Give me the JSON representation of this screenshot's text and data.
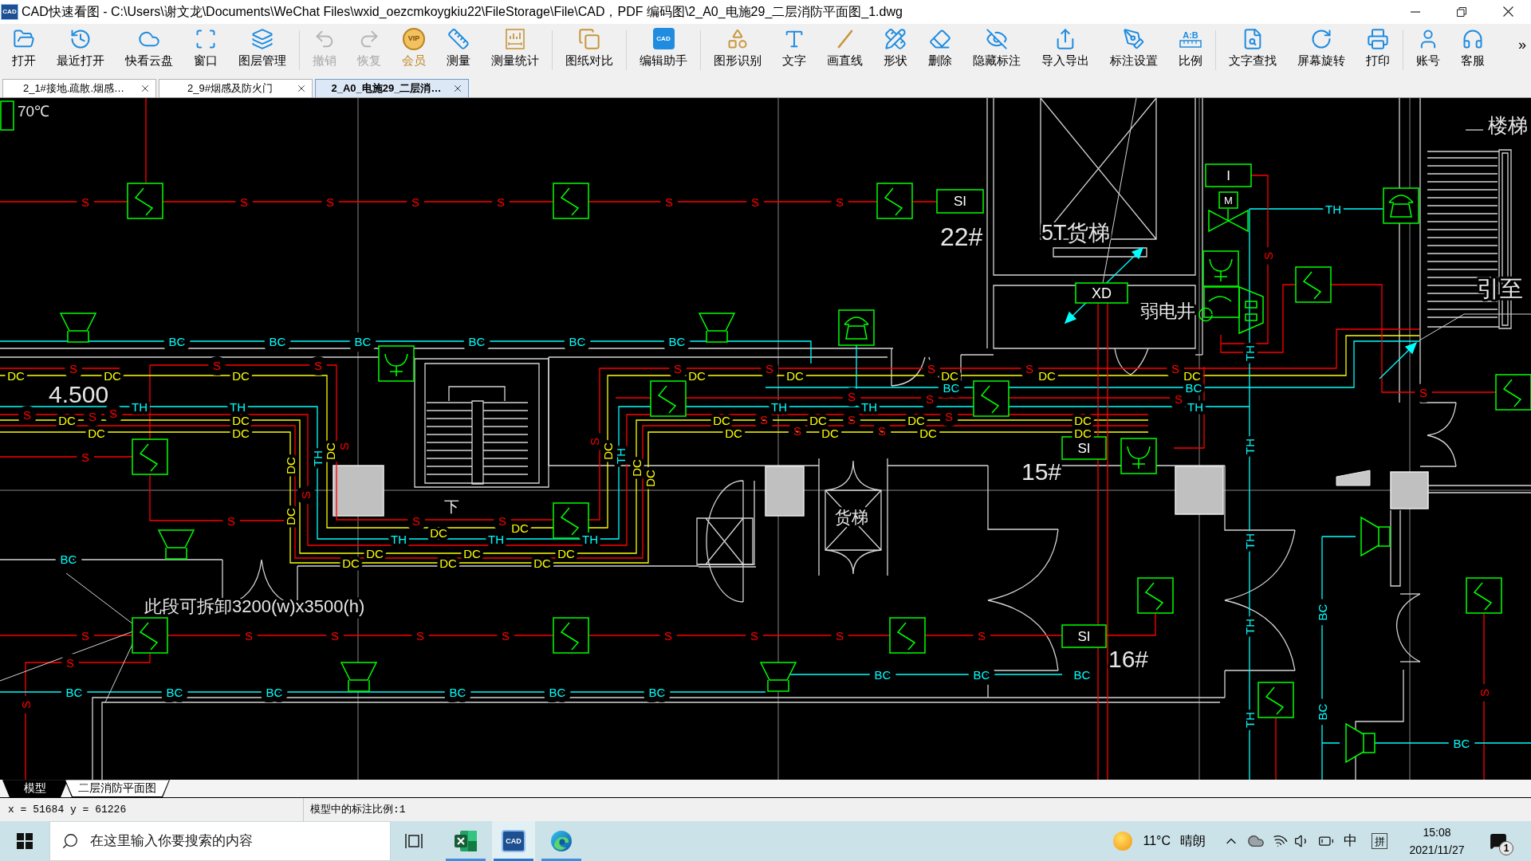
{
  "window": {
    "icon_text": "CAD",
    "title": "CAD快速看图 - C:\\Users\\谢文龙\\Documents\\WeChat Files\\wxid_oezcmkoygkiu22\\FileStorage\\File\\CAD，PDF 编码图\\2_A0_电施29_二层消防平面图_1.dwg"
  },
  "toolbar": {
    "groups": [
      [
        {
          "label": "打开",
          "disabled": false
        },
        {
          "label": "最近打开",
          "disabled": false
        },
        {
          "label": "快看云盘",
          "disabled": false
        },
        {
          "label": "窗口",
          "disabled": false
        },
        {
          "label": "图层管理",
          "disabled": false
        }
      ],
      [
        {
          "label": "撤销",
          "disabled": true
        },
        {
          "label": "恢复",
          "disabled": true
        },
        {
          "label": "会员",
          "disabled": false,
          "icon_text": "VIP"
        },
        {
          "label": "测量",
          "disabled": false
        },
        {
          "label": "测量统计",
          "disabled": false
        }
      ],
      [
        {
          "label": "图纸对比",
          "disabled": false
        }
      ],
      [
        {
          "label": "编辑助手",
          "disabled": false,
          "icon_text": "CAD"
        }
      ],
      [
        {
          "label": "图形识别",
          "disabled": false
        },
        {
          "label": "文字",
          "disabled": false
        },
        {
          "label": "画直线",
          "disabled": false
        },
        {
          "label": "形状",
          "disabled": false
        },
        {
          "label": "删除",
          "disabled": false
        },
        {
          "label": "隐藏标注",
          "disabled": false
        },
        {
          "label": "导入导出",
          "disabled": false
        },
        {
          "label": "标注设置",
          "disabled": false
        },
        {
          "label": "比例",
          "disabled": false,
          "icon_text": "A:B"
        }
      ],
      [
        {
          "label": "文字查找",
          "disabled": false
        },
        {
          "label": "屏幕旋转",
          "disabled": false
        },
        {
          "label": "打印",
          "disabled": false
        }
      ],
      [
        {
          "label": "账号",
          "disabled": false
        },
        {
          "label": "客服",
          "disabled": false
        }
      ]
    ],
    "more": "»"
  },
  "tabs": [
    {
      "label": "2_1#接地.疏散.烟感…",
      "selected": false
    },
    {
      "label": "2_9#烟感及防火门",
      "selected": false
    },
    {
      "label": "2_A0_电施29_二层消…",
      "selected": true
    }
  ],
  "plan": {
    "wire_labels": [
      {
        "color": "#ff0000",
        "texts": [
          "S",
          "S",
          "S",
          "S",
          "S",
          "S",
          "S",
          "S",
          "S",
          "S",
          "S",
          "S",
          "S",
          "S",
          "S",
          "S",
          "S",
          "S",
          "S",
          "S",
          "S",
          "S",
          "S",
          "S",
          "S",
          "S",
          "S",
          "S",
          "S",
          "S",
          "S",
          "S",
          "S",
          "S",
          "S",
          "S",
          "S",
          "S",
          "S",
          "S",
          "S",
          "S",
          "S",
          "S",
          "S",
          "S",
          "S",
          "S"
        ]
      },
      {
        "color": "#00ffff",
        "texts": [
          "BC",
          "BC",
          "BC",
          "BC",
          "BC",
          "BC",
          "BC",
          "BC",
          "BC",
          "BC",
          "BC",
          "BC",
          "BC",
          "BC",
          "BC",
          "BC",
          "BC",
          "BC",
          "BC",
          "BC",
          "BC"
        ]
      },
      {
        "color": "#00ffff",
        "texts": [
          "TH",
          "TH",
          "TH",
          "TH",
          "TH",
          "TH",
          "TH",
          "TH",
          "TH",
          "TH",
          "TH",
          "TH",
          "TH",
          "TH",
          "TH",
          "TH"
        ]
      },
      {
        "color": "#ffff00",
        "texts": [
          "DC",
          "DC",
          "DC",
          "DC",
          "DC",
          "DC",
          "DC",
          "DC",
          "DC",
          "DC",
          "DC",
          "DC",
          "DC",
          "DC",
          "DC",
          "DC",
          "DC",
          "DC",
          "DC",
          "DC",
          "DC",
          "DC",
          "DC",
          "DC",
          "DC",
          "DC",
          "DC",
          "DC",
          "DC",
          "DC",
          "DC",
          "DC",
          "DC",
          "DC"
        ]
      }
    ],
    "tags": [
      "SI",
      "SI",
      "SI",
      "I",
      "M",
      "XD"
    ],
    "room_labels": [
      "70℃",
      "4.500",
      "22#",
      "5T货梯",
      "弱电井",
      "15#",
      "16#",
      "货梯",
      "楼梯",
      "引至",
      "此段可拆卸3200(w)x3500(h)",
      "下"
    ]
  },
  "layout_tabs": [
    {
      "label": "模型",
      "selected": true
    },
    {
      "label": "二层消防平面图",
      "selected": false
    }
  ],
  "status_bar": {
    "coordinates": "x = 51684 y = 61226",
    "annotation_scale": "模型中的标注比例:1"
  },
  "taskbar": {
    "search": {
      "placeholder": "在这里输入你要搜索的内容"
    },
    "apps": [
      {
        "selected": false
      },
      {
        "selected": true,
        "icon_text": "CAD"
      },
      {
        "selected": false
      }
    ],
    "weather": {
      "temperature": "11°C",
      "condition": "晴朗"
    },
    "input_mode": "中",
    "ime": "拼",
    "clock": {
      "time": "15:08",
      "date": "2021/11/27"
    },
    "notifications": "1"
  }
}
